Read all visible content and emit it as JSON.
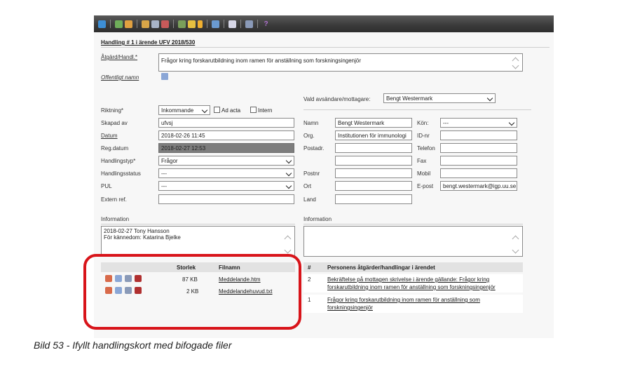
{
  "title": "Handling # 1 i ärende UFV 2018/530",
  "atgard": {
    "label": "Åtgärd/Handl.*",
    "value": "Frågor kring forskarutbildning inom ramen för anställning som forskningsingenjör"
  },
  "offentligt": {
    "label": "Offentligt namn"
  },
  "left_fields": {
    "riktning": {
      "label": "Riktning*",
      "value": "Inkommande",
      "adacta": "Ad acta",
      "intern": "Intern"
    },
    "skapad": {
      "label": "Skapad av",
      "value": "ufvsj"
    },
    "datum": {
      "label": "Datum",
      "value": "2018-02-26 11:45"
    },
    "regdatum": {
      "label": "Reg.datum",
      "value": "2018-02-27 12:53"
    },
    "handlingstyp": {
      "label": "Handlingstyp*",
      "value": "Frågor"
    },
    "handlingsstatus": {
      "label": "Handlingsstatus",
      "value": "---"
    },
    "pul": {
      "label": "PUL",
      "value": "---"
    },
    "extern": {
      "label": "Extern ref.",
      "value": ""
    }
  },
  "right_fields": {
    "vald_label": "Vald avsändare/mottagare:",
    "vald_value": "Bengt Westermark",
    "namn": {
      "label": "Namn",
      "value": "Bengt Westermark"
    },
    "org": {
      "label": "Org.",
      "value": "Institutionen för immunologi"
    },
    "postadr": {
      "label": "Postadr.",
      "value": ""
    },
    "postnr": {
      "label": "Postnr",
      "value": ""
    },
    "ort": {
      "label": "Ort",
      "value": ""
    },
    "land": {
      "label": "Land",
      "value": ""
    },
    "kon": {
      "label": "Kön:",
      "value": "---"
    },
    "idnr": {
      "label": "ID-nr",
      "value": ""
    },
    "telefon": {
      "label": "Telefon",
      "value": ""
    },
    "fax": {
      "label": "Fax",
      "value": ""
    },
    "mobil": {
      "label": "Mobil",
      "value": ""
    },
    "epost": {
      "label": "E-post",
      "value": "bengt.westermark@igp.uu.se"
    }
  },
  "information_left": {
    "label": "Information",
    "line1": "2018-02-27 Tony Hansson",
    "line2": "För kännedom: Katarina Bjelke"
  },
  "information_right": {
    "label": "Information"
  },
  "files": {
    "col_size": "Storlek",
    "col_name": "Filnamn",
    "rows": [
      {
        "size": "87 KB",
        "name": "Meddelande.htm"
      },
      {
        "size": "2 KB",
        "name": "Meddelandehuvud.txt"
      }
    ]
  },
  "person_actions": {
    "col_num": "#",
    "col_title": "Personens åtgärder/handlingar i ärendet",
    "rows": [
      {
        "num": "2",
        "line1": "Bekräftelse på mottagen skrivelse i ärende gällande: Frågor kring",
        "line2": "forskarutbildning inom ramen för anställning som forskningsingenjör"
      },
      {
        "num": "1",
        "line1": "Frågor kring forskarutbildning inom ramen för anställning som",
        "line2": "forskningsingenjör"
      }
    ]
  },
  "caption": "Bild 53 - Ifyllt handlingskort med bifogade filer"
}
